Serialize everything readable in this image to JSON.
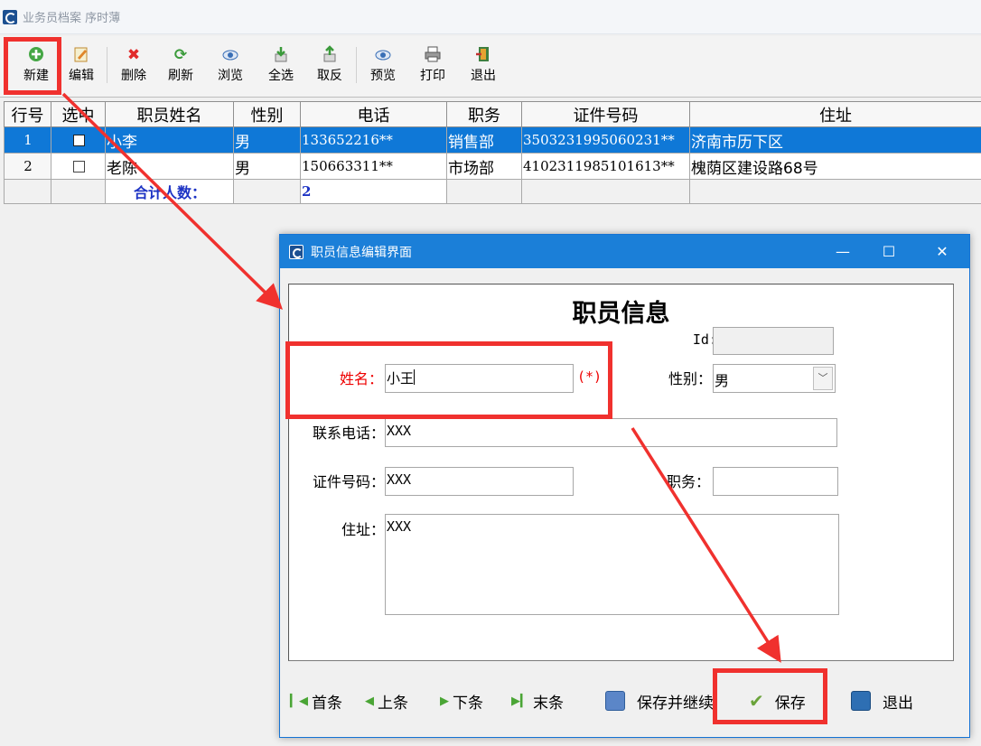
{
  "window": {
    "title": "业务员档案 序时薄"
  },
  "toolbar": {
    "buttons": [
      {
        "label": "新建",
        "icon": "add-icon",
        "color": "#3a9a3a"
      },
      {
        "label": "编辑",
        "icon": "edit-icon",
        "color": "#d0822a"
      },
      {
        "label": "删除",
        "icon": "delete-icon",
        "color": "#e12a2a"
      },
      {
        "label": "刷新",
        "icon": "refresh-icon",
        "color": "#3b9b3b"
      },
      {
        "label": "浏览",
        "icon": "eye-icon",
        "color": "#3a6fb6"
      },
      {
        "label": "全选",
        "icon": "select-all-icon",
        "color": "#3a9a3a"
      },
      {
        "label": "取反",
        "icon": "invert-selection-icon",
        "color": "#3a9a3a"
      },
      {
        "label": "预览",
        "icon": "preview-icon",
        "color": "#3a6fb6"
      },
      {
        "label": "打印",
        "icon": "printer-icon",
        "color": "#555555"
      },
      {
        "label": "退出",
        "icon": "exit-icon",
        "color": "#3a9a3a"
      }
    ]
  },
  "grid": {
    "columns": [
      "行号",
      "选中",
      "职员姓名",
      "性别",
      "电话",
      "职务",
      "证件号码",
      "住址"
    ],
    "rows": [
      {
        "row_no": "1",
        "name": "小李",
        "gender": "男",
        "phone": "133652216**",
        "position": "销售部",
        "id_number": "3503231995060231**",
        "address": "济南市历下区"
      },
      {
        "row_no": "2",
        "name": "老陈",
        "gender": "男",
        "phone": "150663311**",
        "position": "市场部",
        "id_number": "4102311985101613**",
        "address": "槐荫区建设路68号"
      }
    ],
    "summary": {
      "label": "合计人数：",
      "value": "2"
    }
  },
  "dialog": {
    "title": "职员信息编辑界面",
    "controls": {
      "minimize": "—",
      "maximize": "☐",
      "close": "✕"
    },
    "heading": "职员信息",
    "fields": {
      "id": {
        "label": "Id:",
        "value": ""
      },
      "name": {
        "label": "姓名：",
        "value": "小王",
        "required_mark": "(*)"
      },
      "gender": {
        "label": "性别：",
        "value": "男"
      },
      "phone": {
        "label": "联系电话：",
        "value": "XXX"
      },
      "id_number": {
        "label": "证件号码：",
        "value": "XXX"
      },
      "position": {
        "label": "职务：",
        "value": ""
      },
      "address": {
        "label": "住址：",
        "value": "XXX"
      }
    },
    "footer": {
      "first": "首条",
      "prev": "上条",
      "next": "下条",
      "last": "末条",
      "save_continue": "保存并继续",
      "save": "保存",
      "exit": "退出"
    }
  },
  "colors": {
    "accent": "#1b7fd8",
    "selection": "#0f78d7",
    "annotation": "#f0312e",
    "required": "#e00000",
    "summary_text": "#1d33c4"
  }
}
